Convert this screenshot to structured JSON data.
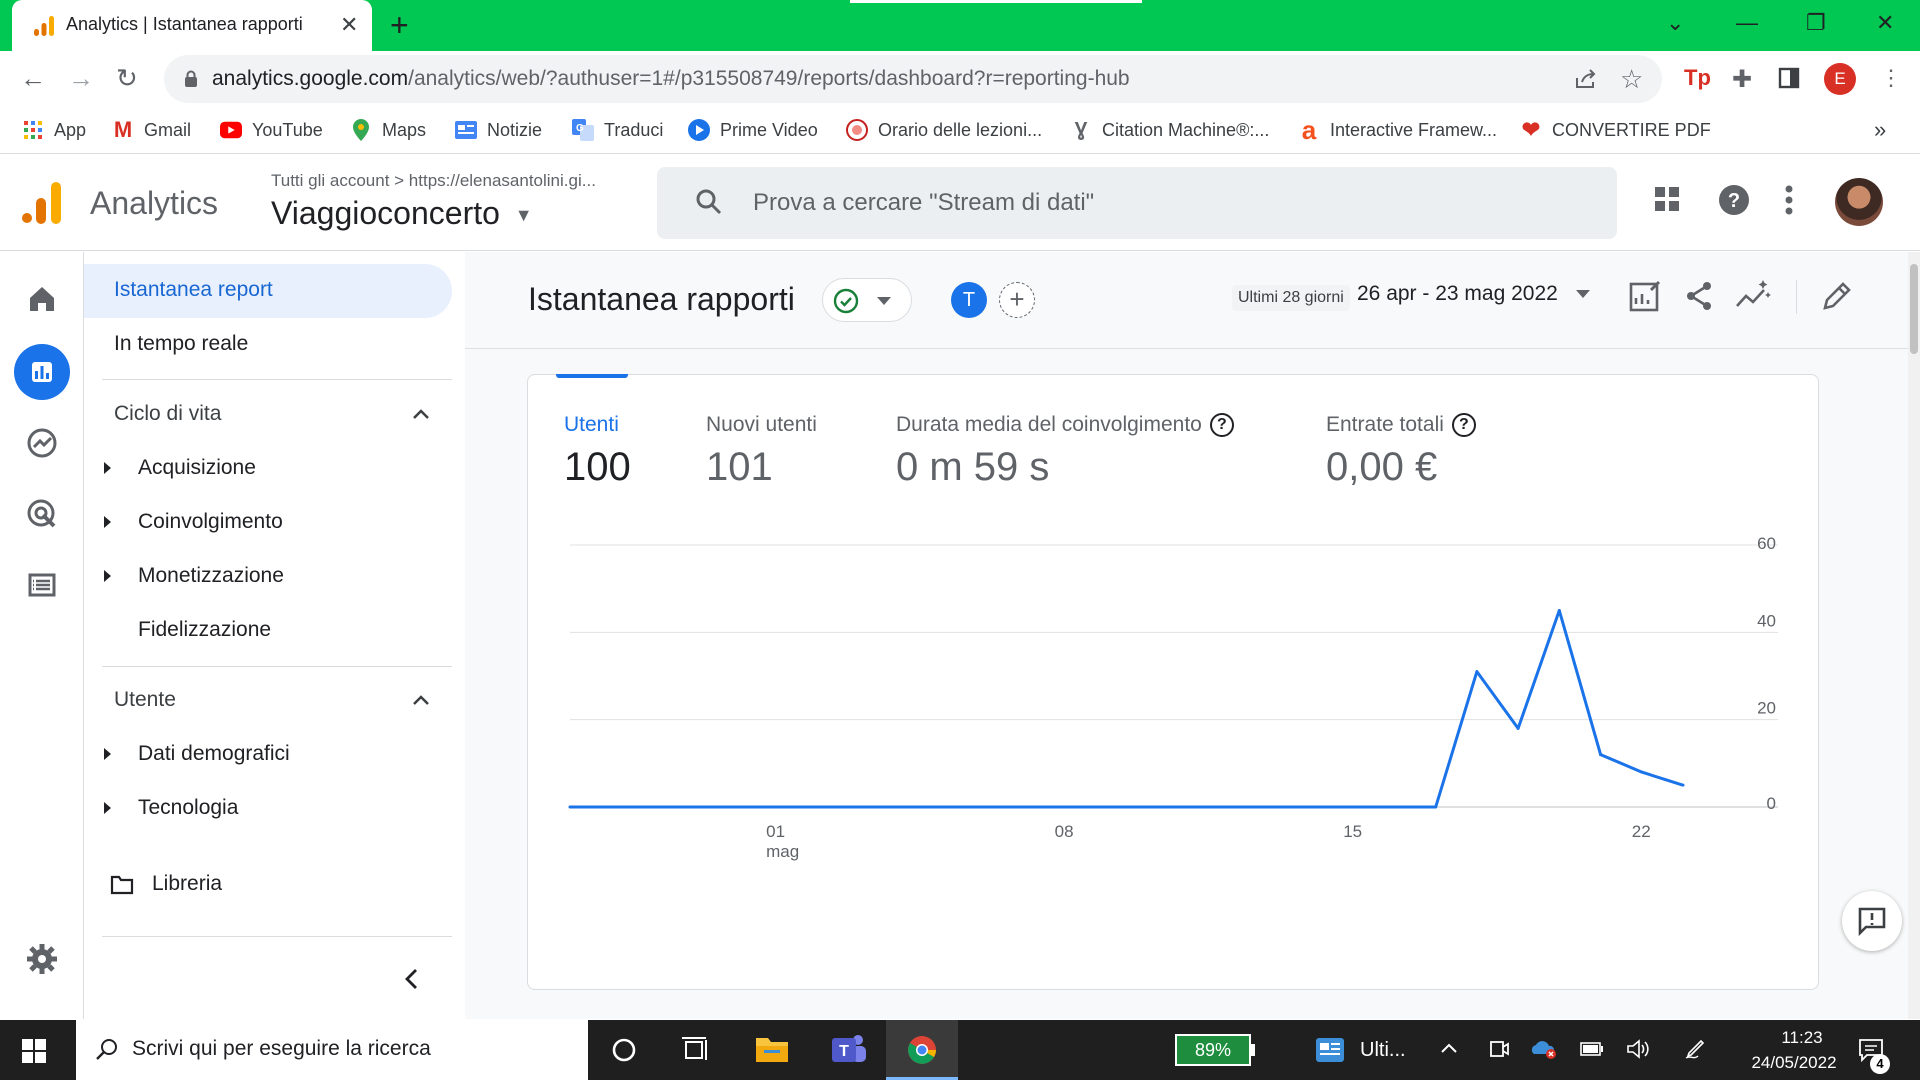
{
  "browser": {
    "tab_title": "Analytics | Istantanea rapporti",
    "url_host": "analytics.google.com",
    "url_path": "/analytics/web/?authuser=1#/p315508749/reports/dashboard?r=reporting-hub",
    "profile_initial": "E",
    "bookmarks": [
      {
        "label": "App",
        "icon": "apps-grid-icon"
      },
      {
        "label": "Gmail",
        "icon": "gmail-icon"
      },
      {
        "label": "YouTube",
        "icon": "youtube-icon"
      },
      {
        "label": "Maps",
        "icon": "maps-pin-icon"
      },
      {
        "label": "Notizie",
        "icon": "news-icon"
      },
      {
        "label": "Traduci",
        "icon": "translate-icon"
      },
      {
        "label": "Prime Video",
        "icon": "prime-video-icon"
      },
      {
        "label": "Orario delle lezioni...",
        "icon": "university-seal-icon"
      },
      {
        "label": "Citation Machine®:...",
        "icon": "citation-machine-icon"
      },
      {
        "label": "Interactive Framew...",
        "icon": "a-logo-icon"
      },
      {
        "label": "CONVERTIRE PDF",
        "icon": "heart-icon"
      }
    ],
    "bookmarks_overflow": "»"
  },
  "ga": {
    "product_name": "Analytics",
    "account_path": "Tutti gli account  >  https://elenasantolini.gi...",
    "property_name": "Viaggioconcerto",
    "search_placeholder": "Prova a cercare \"Stream di dati\""
  },
  "nav": {
    "snapshot": "Istantanea report",
    "realtime": "In tempo reale",
    "lifecycle": "Ciclo di vita",
    "lifecycle_items": [
      "Acquisizione",
      "Coinvolgimento",
      "Monetizzazione",
      "Fidelizzazione"
    ],
    "user": "Utente",
    "user_items": [
      "Dati demografici",
      "Tecnologia"
    ],
    "library": "Libreria"
  },
  "report": {
    "title": "Istantanea rapporti",
    "compare_initial": "T",
    "compare_add": "+",
    "date_range_label": "Ultimi 28 giorni",
    "date_range": "26 apr - 23 mag 2022",
    "metrics": [
      {
        "label": "Utenti",
        "value": "100",
        "help": false
      },
      {
        "label": "Nuovi utenti",
        "value": "101",
        "help": false
      },
      {
        "label": "Durata media del coinvolgimento",
        "value": "0 m 59 s",
        "help": true
      },
      {
        "label": "Entrate totali",
        "value": "0,00 €",
        "help": true
      }
    ]
  },
  "chart_data": {
    "type": "line",
    "x": [
      "26 apr",
      "27 apr",
      "28 apr",
      "29 apr",
      "30 apr",
      "01 mag",
      "02 mag",
      "03 mag",
      "04 mag",
      "05 mag",
      "06 mag",
      "07 mag",
      "08 mag",
      "09 mag",
      "10 mag",
      "11 mag",
      "12 mag",
      "13 mag",
      "14 mag",
      "15 mag",
      "16 mag",
      "17 mag",
      "18 mag",
      "19 mag",
      "20 mag",
      "21 mag",
      "22 mag",
      "23 mag"
    ],
    "series": [
      {
        "name": "Utenti",
        "color": "#1a73e8",
        "values": [
          0,
          0,
          0,
          0,
          0,
          0,
          0,
          0,
          0,
          0,
          0,
          0,
          0,
          0,
          0,
          0,
          0,
          0,
          0,
          0,
          0,
          0,
          31,
          18,
          45,
          12,
          8,
          5
        ]
      }
    ],
    "xticks": [
      {
        "index": 5,
        "label": "01",
        "sublabel": "mag"
      },
      {
        "index": 12,
        "label": "08",
        "sublabel": ""
      },
      {
        "index": 19,
        "label": "15",
        "sublabel": ""
      },
      {
        "index": 26,
        "label": "22",
        "sublabel": ""
      }
    ],
    "yticks": [
      0,
      20,
      40,
      60
    ],
    "ylim": [
      0,
      60
    ],
    "y_axis_side": "right",
    "grid": true
  },
  "taskbar": {
    "search_placeholder": "Scrivi qui per eseguire la ricerca",
    "battery": "89%",
    "news_label": "Ulti...",
    "time": "11:23",
    "date": "24/05/2022",
    "notifications": "4"
  }
}
